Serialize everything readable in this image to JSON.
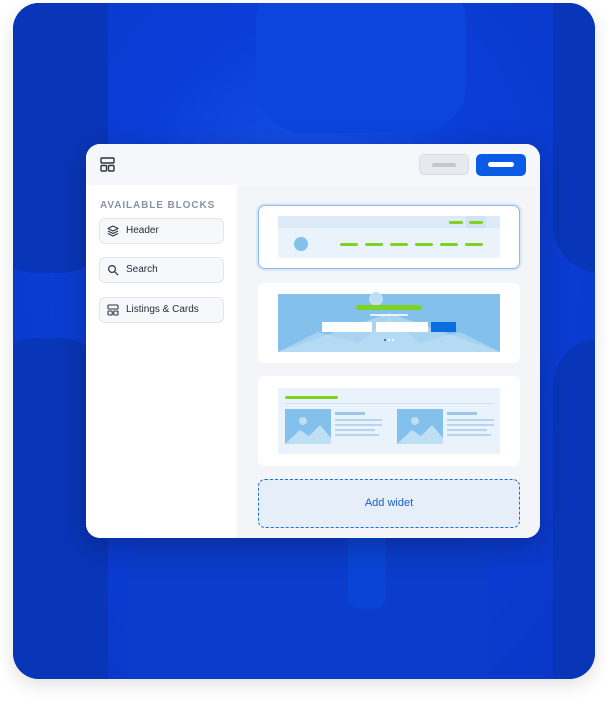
{
  "sidebar": {
    "title": "AVAILABLE BLOCKS",
    "items": [
      {
        "label": "Header",
        "icon": "layers-icon"
      },
      {
        "label": "Search",
        "icon": "search-icon"
      },
      {
        "label": "Listings & Cards",
        "icon": "layout-icon"
      }
    ]
  },
  "canvas": {
    "blocks": [
      "header-preview",
      "hero-search-preview",
      "listings-preview"
    ],
    "add_widget_label": "Add widet"
  },
  "colors": {
    "background": "#0b3fd9",
    "accent": "#0a5ce6",
    "preview_green": "#7ed321",
    "preview_blue": "#84c0ec"
  }
}
